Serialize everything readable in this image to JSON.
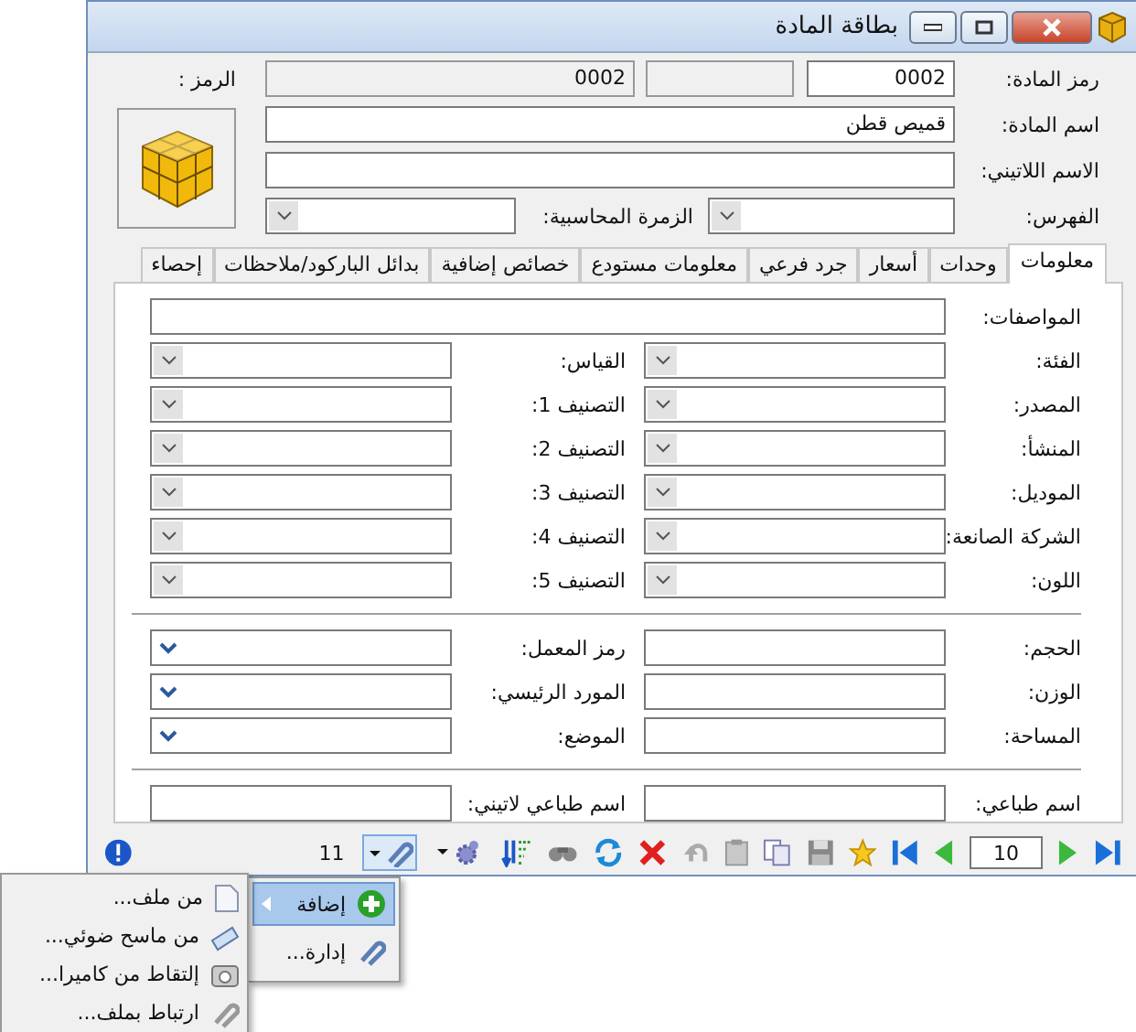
{
  "window": {
    "title": "بطاقة المادة"
  },
  "header": {
    "code_label": "رمز المادة:",
    "code_value": "0002",
    "mirror_value": "0002",
    "symbol_label": "الرمز :",
    "name_label": "اسم المادة:",
    "name_value": "قميص قطن",
    "latin_label": "الاسم اللاتيني:",
    "index_label": "الفهرس:",
    "account_group_label": "الزمرة المحاسبية:"
  },
  "tabs": [
    {
      "label": "معلومات",
      "selected": true
    },
    {
      "label": "وحدات",
      "selected": false
    },
    {
      "label": "أسعار",
      "selected": false
    },
    {
      "label": "جرد فرعي",
      "selected": false
    },
    {
      "label": "معلومات مستودع",
      "selected": false
    },
    {
      "label": "خصائص إضافية",
      "selected": false
    },
    {
      "label": "بدائل الباركود/ملاحظات",
      "selected": false
    },
    {
      "label": "إحصاء",
      "selected": false
    }
  ],
  "info": {
    "description_label": "المواصفات:",
    "sections": [
      [
        [
          {
            "label": "الفئة:",
            "kind": "combo"
          },
          {
            "label": "القياس:",
            "kind": "combo"
          }
        ],
        [
          {
            "label": "المصدر:",
            "kind": "combo"
          },
          {
            "label": "التصنيف 1:",
            "kind": "combo"
          }
        ],
        [
          {
            "label": "المنشأ:",
            "kind": "combo"
          },
          {
            "label": "التصنيف 2:",
            "kind": "combo"
          }
        ],
        [
          {
            "label": "الموديل:",
            "kind": "combo"
          },
          {
            "label": "التصنيف 3:",
            "kind": "combo"
          }
        ],
        [
          {
            "label": "الشركة الصانعة:",
            "kind": "combo"
          },
          {
            "label": "التصنيف 4:",
            "kind": "combo"
          }
        ],
        [
          {
            "label": "اللون:",
            "kind": "combo"
          },
          {
            "label": "التصنيف 5:",
            "kind": "combo"
          }
        ]
      ],
      [
        [
          {
            "label": "الحجم:",
            "kind": "text"
          },
          {
            "label": "رمز المعمل:",
            "kind": "select"
          }
        ],
        [
          {
            "label": "الوزن:",
            "kind": "text"
          },
          {
            "label": "المورد الرئيسي:",
            "kind": "select"
          }
        ],
        [
          {
            "label": "المساحة:",
            "kind": "text"
          },
          {
            "label": "الموضع:",
            "kind": "select"
          }
        ]
      ],
      [
        [
          {
            "label": "اسم طباعي:",
            "kind": "text"
          },
          {
            "label": "اسم طباعي لاتيني:",
            "kind": "text"
          }
        ]
      ]
    ]
  },
  "toolbar": {
    "attachments_count": "11",
    "record_number": "10"
  },
  "menu": {
    "items": [
      {
        "label": "إضافة",
        "selected": true,
        "submenu": true
      },
      {
        "label": "إدارة...",
        "selected": false,
        "submenu": false
      }
    ]
  },
  "submenu": {
    "items": [
      {
        "label": "من ملف..."
      },
      {
        "label": "من ماسح ضوئي..."
      },
      {
        "label": "إلتقاط من كاميرا..."
      },
      {
        "label": "ارتباط بملف..."
      }
    ]
  }
}
